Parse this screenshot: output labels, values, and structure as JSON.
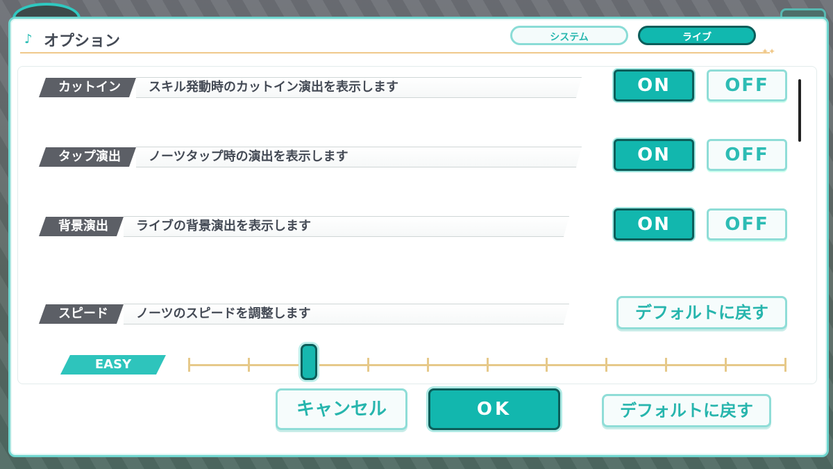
{
  "header": {
    "title": "オプション",
    "icon": "music-note-icon",
    "tabs": [
      {
        "label": "システム",
        "active": false
      },
      {
        "label": "ライブ",
        "active": true
      }
    ]
  },
  "settings": [
    {
      "label": "カットイン",
      "description": "スキル発動時のカットイン演出を表示します",
      "on_label": "ON",
      "off_label": "OFF",
      "value": "ON"
    },
    {
      "label": "タップ演出",
      "description": "ノーツタップ時の演出を表示します",
      "on_label": "ON",
      "off_label": "OFF",
      "value": "ON"
    },
    {
      "label": "背景演出",
      "description": "ライブの背景演出を表示します",
      "on_label": "ON",
      "off_label": "OFF",
      "value": "ON"
    }
  ],
  "speed": {
    "label": "スピード",
    "description": "ノーツのスピードを調整します",
    "default_button": "デフォルトに戻す",
    "difficulty_label": "EASY",
    "steps": 11,
    "selected_step": 3
  },
  "footer": {
    "cancel": "キャンセル",
    "ok": "OK",
    "default": "デフォルトに戻す"
  },
  "colors": {
    "accent": "#12b7ae",
    "accent_dark": "#0c5e5a",
    "label_bg": "#5c5f66",
    "slider": "#e6c98a"
  }
}
